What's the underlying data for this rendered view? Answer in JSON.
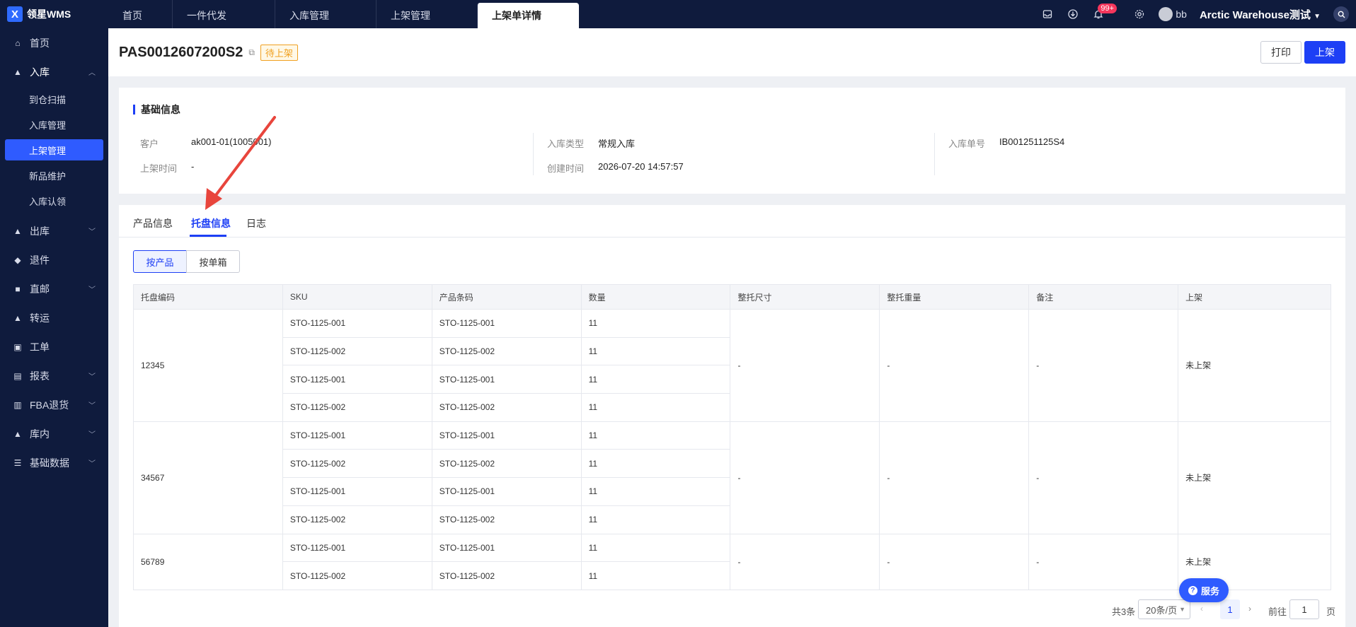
{
  "app": {
    "logo_text": "领星WMS",
    "logo_mark": "X"
  },
  "top_tabs": [
    {
      "label": "首页"
    },
    {
      "label": "一件代发"
    },
    {
      "label": "入库管理"
    },
    {
      "label": "上架管理"
    },
    {
      "label": "上架单详情"
    }
  ],
  "topbar": {
    "badge": "99+",
    "user": "bb",
    "warehouse": "Arctic Warehouse测试"
  },
  "sidebar": {
    "items": [
      {
        "label": "首页"
      },
      {
        "label": "入库"
      },
      {
        "label": "出库"
      },
      {
        "label": "退件"
      },
      {
        "label": "直邮"
      },
      {
        "label": "转运"
      },
      {
        "label": "工单"
      },
      {
        "label": "报表"
      },
      {
        "label": "FBA退货"
      },
      {
        "label": "库内"
      },
      {
        "label": "基础数据"
      }
    ],
    "sub_items": [
      {
        "label": "到仓扫描"
      },
      {
        "label": "入库管理"
      },
      {
        "label": "上架管理"
      },
      {
        "label": "新品维护"
      },
      {
        "label": "入库认领"
      }
    ]
  },
  "header": {
    "doc_no": "PAS0012607200S2",
    "status": "待上架",
    "print_label": "打印",
    "putaway_label": "上架"
  },
  "basic": {
    "title": "基础信息",
    "customer_k": "客户",
    "customer_v": "ak001-01(1005001)",
    "putaway_time_k": "上架时间",
    "putaway_time_v": "-",
    "inbound_type_k": "入库类型",
    "inbound_type_v": "常规入库",
    "created_k": "创建时间",
    "created_v": "2026-07-20 14:57:57",
    "inbound_no_k": "入库单号",
    "inbound_no_v": "IB001251125S4"
  },
  "detail_tabs": [
    {
      "label": "产品信息"
    },
    {
      "label": "托盘信息"
    },
    {
      "label": "日志"
    }
  ],
  "segment": {
    "by_product": "按产品",
    "by_box": "按单箱"
  },
  "table": {
    "headers": [
      "托盘编码",
      "SKU",
      "产品条码",
      "数量",
      "整托尺寸",
      "整托重量",
      "备注",
      "上架"
    ],
    "pallets": [
      {
        "code": "12345",
        "size": "-",
        "weight": "-",
        "remark": "-",
        "status": "未上架",
        "rows": [
          {
            "sku": "STO-1125-001",
            "barcode": "STO-1125-001",
            "qty": "11"
          },
          {
            "sku": "STO-1125-002",
            "barcode": "STO-1125-002",
            "qty": "11"
          },
          {
            "sku": "STO-1125-001",
            "barcode": "STO-1125-001",
            "qty": "11"
          },
          {
            "sku": "STO-1125-002",
            "barcode": "STO-1125-002",
            "qty": "11"
          }
        ]
      },
      {
        "code": "34567",
        "size": "-",
        "weight": "-",
        "remark": "-",
        "status": "未上架",
        "rows": [
          {
            "sku": "STO-1125-001",
            "barcode": "STO-1125-001",
            "qty": "11"
          },
          {
            "sku": "STO-1125-002",
            "barcode": "STO-1125-002",
            "qty": "11"
          },
          {
            "sku": "STO-1125-001",
            "barcode": "STO-1125-001",
            "qty": "11"
          },
          {
            "sku": "STO-1125-002",
            "barcode": "STO-1125-002",
            "qty": "11"
          }
        ]
      },
      {
        "code": "56789",
        "size": "-",
        "weight": "-",
        "remark": "-",
        "status": "未上架",
        "rows": [
          {
            "sku": "STO-1125-001",
            "barcode": "STO-1125-001",
            "qty": "11"
          },
          {
            "sku": "STO-1125-002",
            "barcode": "STO-1125-002",
            "qty": "11"
          }
        ]
      }
    ]
  },
  "pager": {
    "total": "共3条",
    "page_size": "20条/页",
    "current_page": "1",
    "goto_label": "前往",
    "goto_value": "1",
    "page_unit": "页"
  },
  "service": {
    "label": "服务"
  },
  "colors": {
    "accent": "#1d3ff5",
    "sidebar_bg": "#0f1b3d",
    "annotation_arrow": "#e8453c",
    "status_tag": "#f0a020"
  }
}
